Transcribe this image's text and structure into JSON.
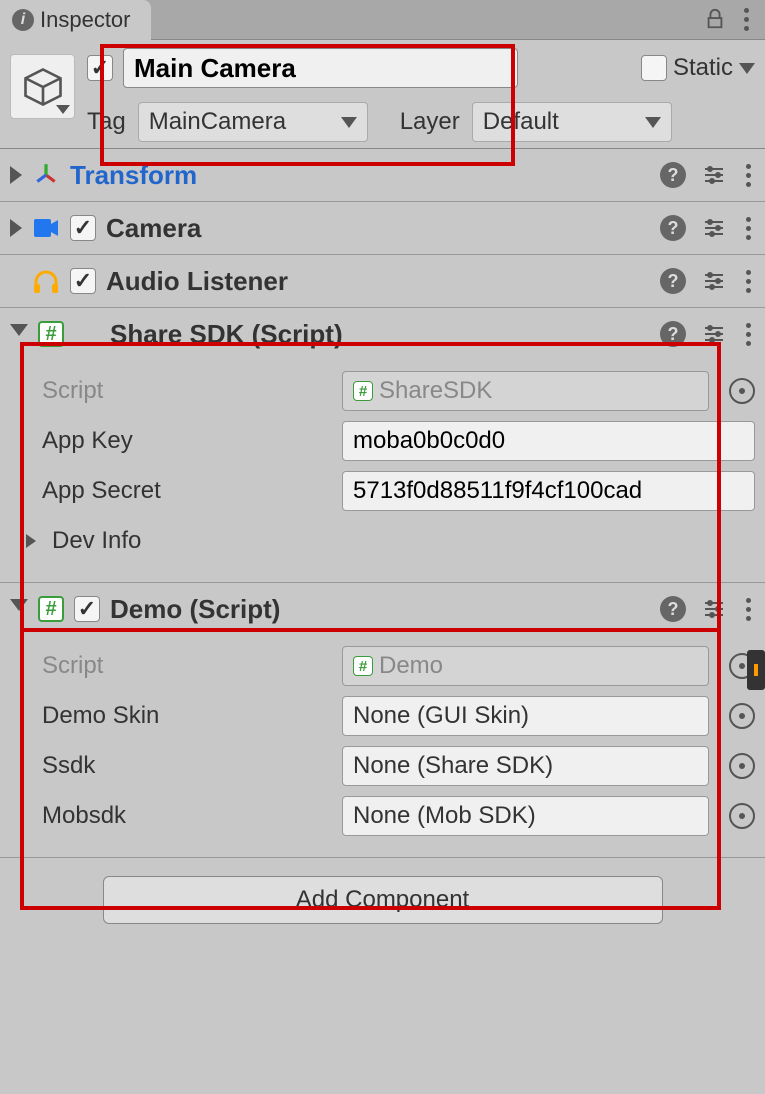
{
  "tab": {
    "title": "Inspector"
  },
  "header": {
    "enabled": true,
    "name": "Main Camera",
    "static_label": "Static",
    "static_checked": false,
    "tag_label": "Tag",
    "tag_value": "MainCamera",
    "layer_label": "Layer",
    "layer_value": "Default"
  },
  "components": {
    "transform": {
      "title": "Transform",
      "expanded": false
    },
    "camera": {
      "title": "Camera",
      "enabled": true,
      "expanded": false
    },
    "audio": {
      "title": "Audio Listener",
      "enabled": true
    },
    "sharesdk": {
      "title": "Share SDK (Script)",
      "expanded": true,
      "script_label": "Script",
      "script_value": "ShareSDK",
      "appkey_label": "App Key",
      "appkey_value": "moba0b0c0d0",
      "appsecret_label": "App Secret",
      "appsecret_value": "5713f0d88511f9f4cf100cad",
      "devinfo_label": "Dev Info"
    },
    "demo": {
      "title": "Demo (Script)",
      "enabled": true,
      "expanded": true,
      "script_label": "Script",
      "script_value": "Demo",
      "skin_label": "Demo Skin",
      "skin_value": "None (GUI Skin)",
      "ssdk_label": "Ssdk",
      "ssdk_value": "None (Share SDK)",
      "mobsdk_label": "Mobsdk",
      "mobsdk_value": "None (Mob SDK)"
    }
  },
  "footer": {
    "add_component": "Add Component"
  }
}
